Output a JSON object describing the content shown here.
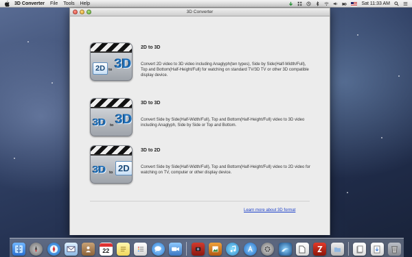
{
  "menubar": {
    "app_name": "3D Converter",
    "items": [
      "File",
      "Tools",
      "Help"
    ],
    "clock": "Sat 11:33 AM"
  },
  "window": {
    "title": "3D Converter",
    "options": [
      {
        "title": "2D to 3D",
        "icon": "2d-to-3d-icon",
        "description": "Convert 2D video to 3D video including Anaglyph(ten types), Side by Side(Half-Width/Full), Top and Bottom(Half-Height/Full) for watching on standard TV/3D TV or other 3D compatible display device."
      },
      {
        "title": "3D to 3D",
        "icon": "3d-to-3d-icon",
        "description": "Convert Side by Side(Half-Width/Full), Top and Bottom(Half-Height/Full) video to 3D video including Anaglyph, Side by Side or Top and Bottom."
      },
      {
        "title": "3D to 2D",
        "icon": "3d-to-2d-icon",
        "description": "Convert Side by Side(Half-Width/Full), Top and Bottom(Half-Height/Full) video to 2D video for watching on TV, computer or other display device."
      }
    ],
    "icon_labels": {
      "2d": "2D",
      "3d": "3D",
      "to": "to"
    },
    "learn_more": "Learn more about 3D format"
  },
  "dock": {
    "calendar_day": "22",
    "apps": [
      "finder-icon",
      "launchpad-icon",
      "safari-icon",
      "mail-icon",
      "contacts-icon",
      "calendar-icon",
      "notes-icon",
      "reminders-icon",
      "messages-icon",
      "facetime-icon",
      "photo-booth-icon",
      "iphoto-icon",
      "itunes-icon",
      "app-store-icon",
      "system-preferences-icon",
      "3d-converter-icon",
      "preview-icon",
      "filezilla-icon",
      "trash-icon"
    ]
  }
}
